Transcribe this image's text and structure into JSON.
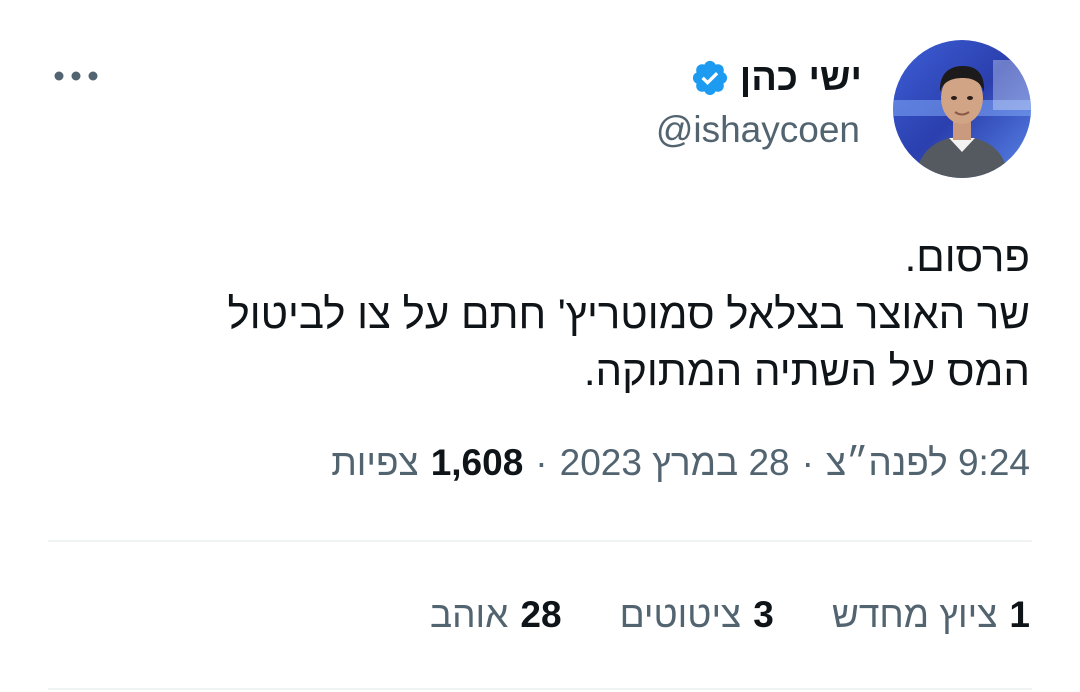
{
  "author": {
    "display_name": "ישי כהן",
    "handle": "@ishaycoen",
    "verified": true,
    "verified_color": "#1d9bf0"
  },
  "icons": {
    "verified": "verified-badge-icon",
    "more": "more-options-icon"
  },
  "tweet": {
    "lines": [
      "פרסום.",
      "שר האוצר בצלאל סמוטריץ' חתם על צו לביטול",
      "המס על השתיה המתוקה."
    ]
  },
  "meta": {
    "time": "9:24 לפנה״צ",
    "date": "28 במרץ 2023",
    "separator": "·",
    "views_count": "1,608",
    "views_label": "צפיות"
  },
  "stats": [
    {
      "count": "1",
      "label": "ציוץ מחדש"
    },
    {
      "count": "3",
      "label": "ציטוטים"
    },
    {
      "count": "28",
      "label": "אוהב"
    }
  ],
  "colors": {
    "primary_text": "#0f1419",
    "secondary_text": "#536471",
    "divider": "#eff3f4"
  }
}
